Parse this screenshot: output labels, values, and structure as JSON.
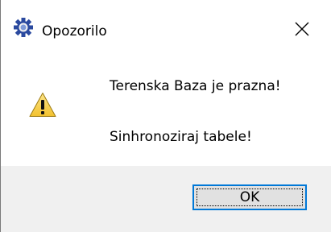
{
  "window": {
    "title": "Opozorilo",
    "icons": {
      "app": "gear-icon",
      "close": "close-icon",
      "message": "warning-icon"
    }
  },
  "message": {
    "line1": "Terenska Baza je prazna!",
    "line2": "Sinhronoziraj tabele!"
  },
  "buttons": {
    "ok_label": "OK"
  },
  "colors": {
    "focus_border": "#0078d7",
    "button_bg": "#e1e1e1",
    "footer_bg": "#f0f0f0",
    "warning_yellow": "#f7d13a"
  }
}
